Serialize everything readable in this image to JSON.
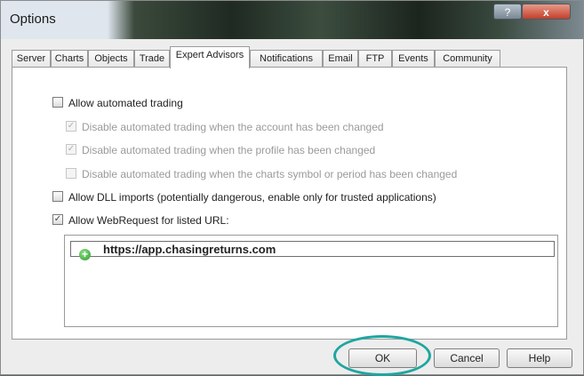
{
  "window": {
    "title": "Options"
  },
  "tabs": [
    {
      "label": "Server"
    },
    {
      "label": "Charts"
    },
    {
      "label": "Objects"
    },
    {
      "label": "Trade"
    },
    {
      "label": "Expert Advisors"
    },
    {
      "label": "Notifications"
    },
    {
      "label": "Email"
    },
    {
      "label": "FTP"
    },
    {
      "label": "Events"
    },
    {
      "label": "Community"
    }
  ],
  "active_tab": "Expert Advisors",
  "options": {
    "allow_automated_trading": {
      "label": "Allow automated trading",
      "checked": false
    },
    "disable_account_change": {
      "label": "Disable automated trading when the account has been changed",
      "checked": true,
      "enabled": false
    },
    "disable_profile_change": {
      "label": "Disable automated trading when the profile has been changed",
      "checked": true,
      "enabled": false
    },
    "disable_symbol_change": {
      "label": "Disable automated trading when the charts symbol or period has been changed",
      "checked": false,
      "enabled": false
    },
    "allow_dll_imports": {
      "label": "Allow DLL imports (potentially dangerous, enable only for trusted applications)",
      "checked": false
    },
    "allow_webrequest": {
      "label": "Allow WebRequest for listed URL:",
      "checked": true
    }
  },
  "url_list": {
    "entries": [
      "https://app.chasingreturns.com"
    ]
  },
  "buttons": {
    "ok": "OK",
    "cancel": "Cancel",
    "help": "Help"
  },
  "caption_buttons": {
    "help": "?",
    "close": "x"
  },
  "colors": {
    "highlight_circle": "#1fa6a0"
  }
}
